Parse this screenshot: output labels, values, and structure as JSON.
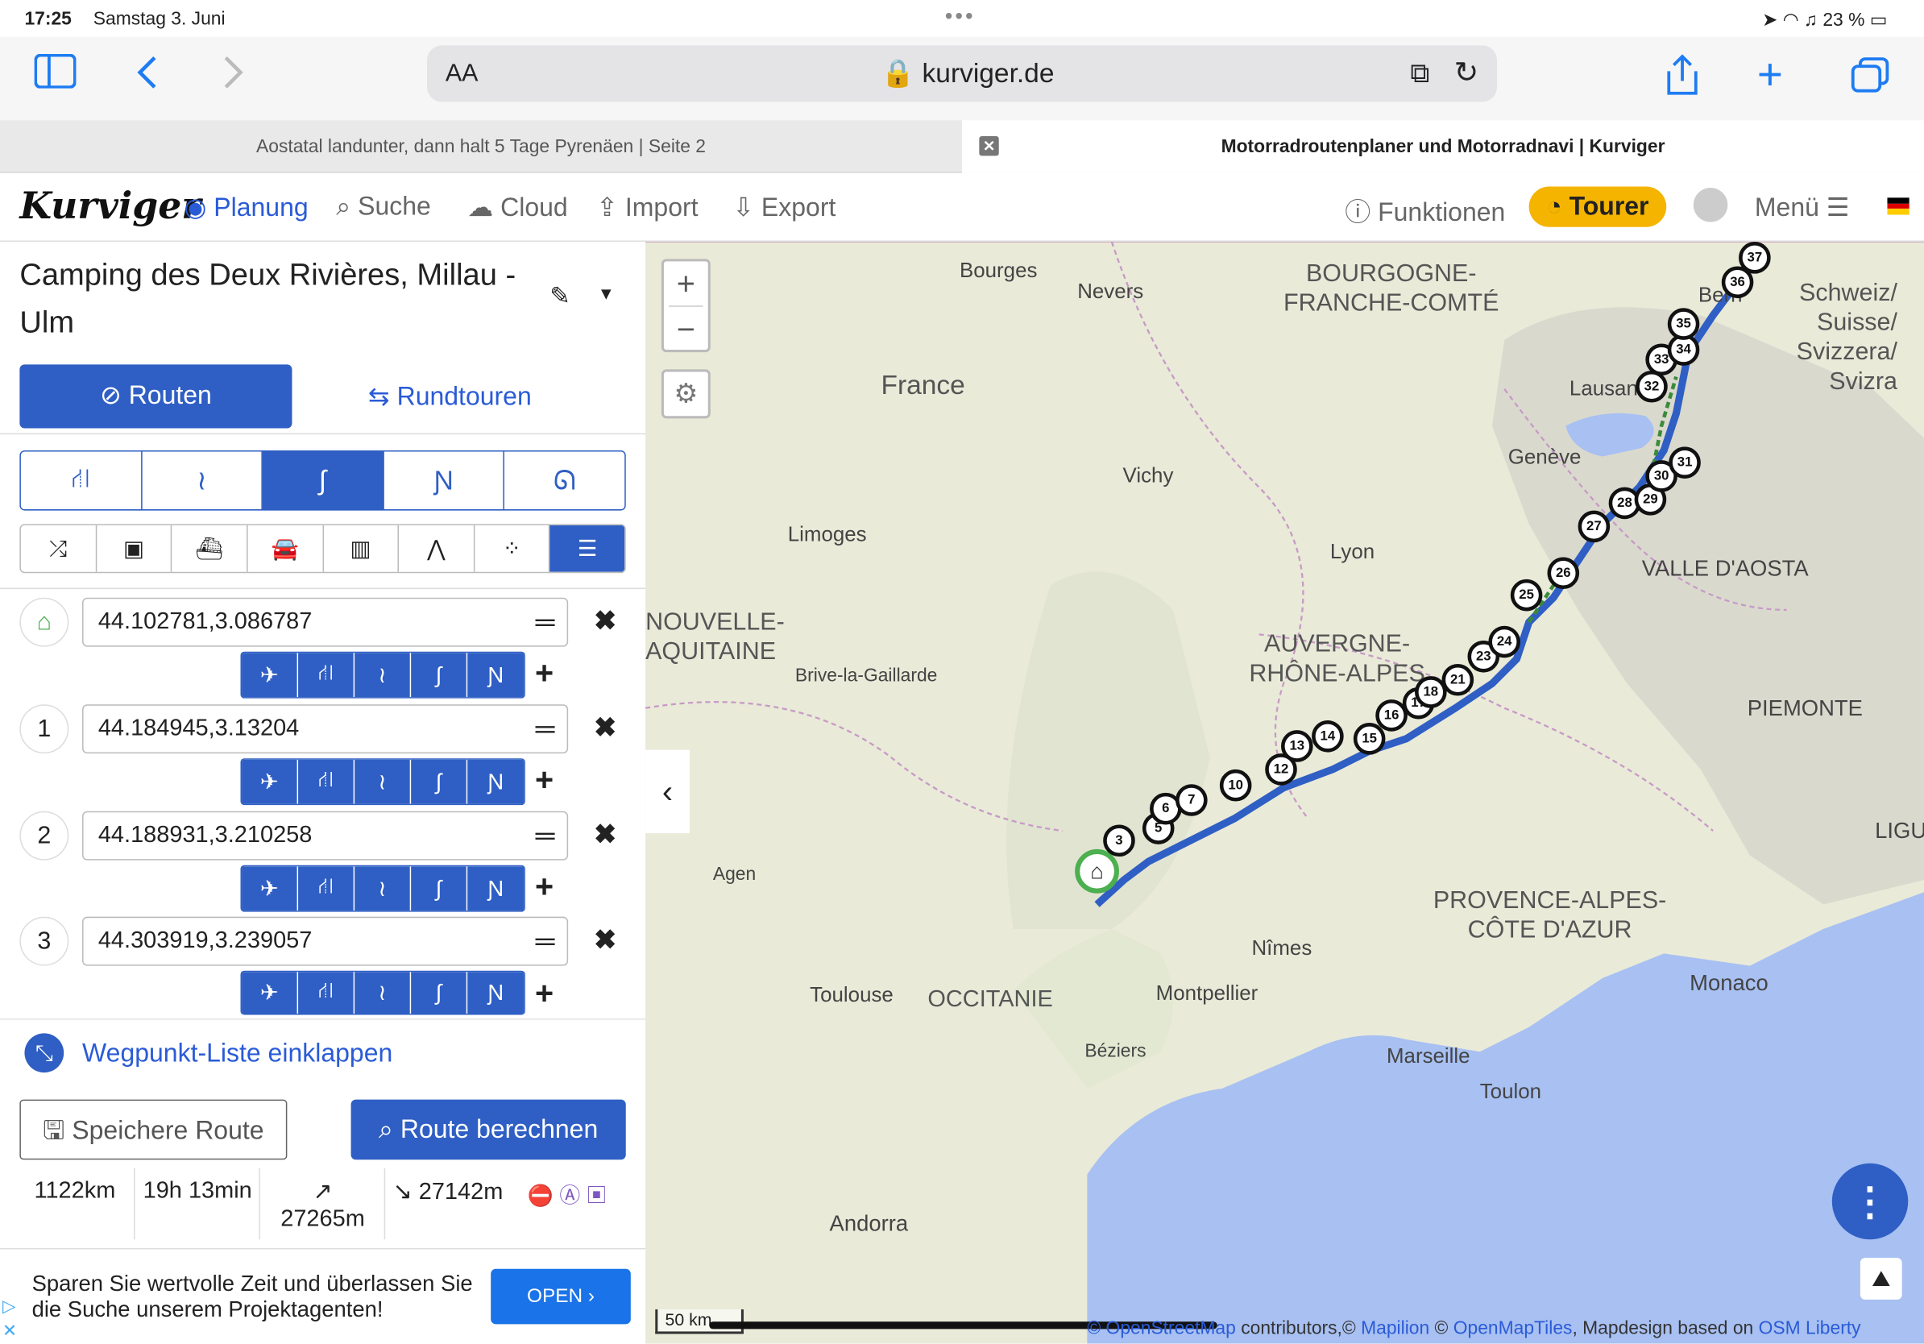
{
  "status": {
    "time": "17:25",
    "date": "Samstag 3. Juni",
    "battery": "23 %"
  },
  "browser": {
    "text_size": "AA",
    "url": "kurviger.de"
  },
  "tabs": [
    {
      "label": "Aostatal landunter, dann halt 5 Tage Pyrenäen | Seite 2"
    },
    {
      "label": "Motorradroutenplaner und Motorradnavi | Kurviger"
    }
  ],
  "nav": {
    "logo": "Kurviger",
    "planung": "Planung",
    "suche": "Suche",
    "cloud": "Cloud",
    "import": "Import",
    "export": "Export",
    "funktionen": "Funktionen",
    "tourer": "Tourer",
    "menu": "Menü"
  },
  "route": {
    "title": "Camping des Deux Rivières, Millau - Ulm",
    "tab_routes": "Routen",
    "tab_roundtrips": "Rundtouren"
  },
  "waypoints": [
    {
      "num": "",
      "value": "44.102781,3.086787"
    },
    {
      "num": "1",
      "value": "44.184945,3.13204"
    },
    {
      "num": "2",
      "value": "44.188931,3.210258"
    },
    {
      "num": "3",
      "value": "44.303919,3.239057"
    }
  ],
  "collapse_label": "Wegpunkt-Liste einklappen",
  "save_label": "Speichere Route",
  "calc_label": "Route berechnen",
  "stats": {
    "distance": "1122km",
    "duration": "19h 13min",
    "ascent": "27265m",
    "descent": "27142m"
  },
  "ad": {
    "text": "Sparen Sie wertvolle Zeit und überlassen Sie die Suche unserem Projektagenten!",
    "button": "OPEN"
  },
  "map": {
    "labels": [
      "Bourges",
      "Nevers",
      "France",
      "Vichy",
      "Limoges",
      "Lyon",
      "Brive-la-Gaillarde",
      "Agen",
      "Toulouse",
      "OCCITANIE",
      "Montpellier",
      "Nîmes",
      "Béziers",
      "Marseille",
      "Toulon",
      "Monaco",
      "Andorra",
      "Genève",
      "Lausanne",
      "Bern",
      "PIEMONTE",
      "VALLE D'AOSTA",
      "LIGU"
    ],
    "regions": {
      "bfc": "BOURGOGNE-\nFRANCHE-COMTÉ",
      "aura": "AUVERGNE-\nRHÔNE-ALPES",
      "paca": "PROVENCE-ALPES-\nCÔTE D'AZUR",
      "na": "NOUVELLE-\nAQUITAINE",
      "ch": "Schweiz/\nSuisse/\nSvizzera/\nSvizra"
    },
    "markers": [
      "3",
      "5",
      "6",
      "7",
      "10",
      "12",
      "13",
      "14",
      "15",
      "16",
      "17",
      "18",
      "21",
      "23",
      "24",
      "25",
      "26",
      "27",
      "28",
      "29",
      "30",
      "31",
      "32",
      "33",
      "34",
      "35",
      "36",
      "37"
    ],
    "scale": "50 km",
    "attribution": {
      "a": "© OpenStreetMap",
      "b": " contributors,© ",
      "c": "Mapilion",
      "d": " © ",
      "e": "OpenMapTiles",
      "f": ", Mapdesign based on ",
      "g": "OSM Liberty"
    }
  },
  "colors": {
    "primary": "#2f5fc4",
    "tourer": "#f5b400",
    "home": "#4caf50"
  }
}
